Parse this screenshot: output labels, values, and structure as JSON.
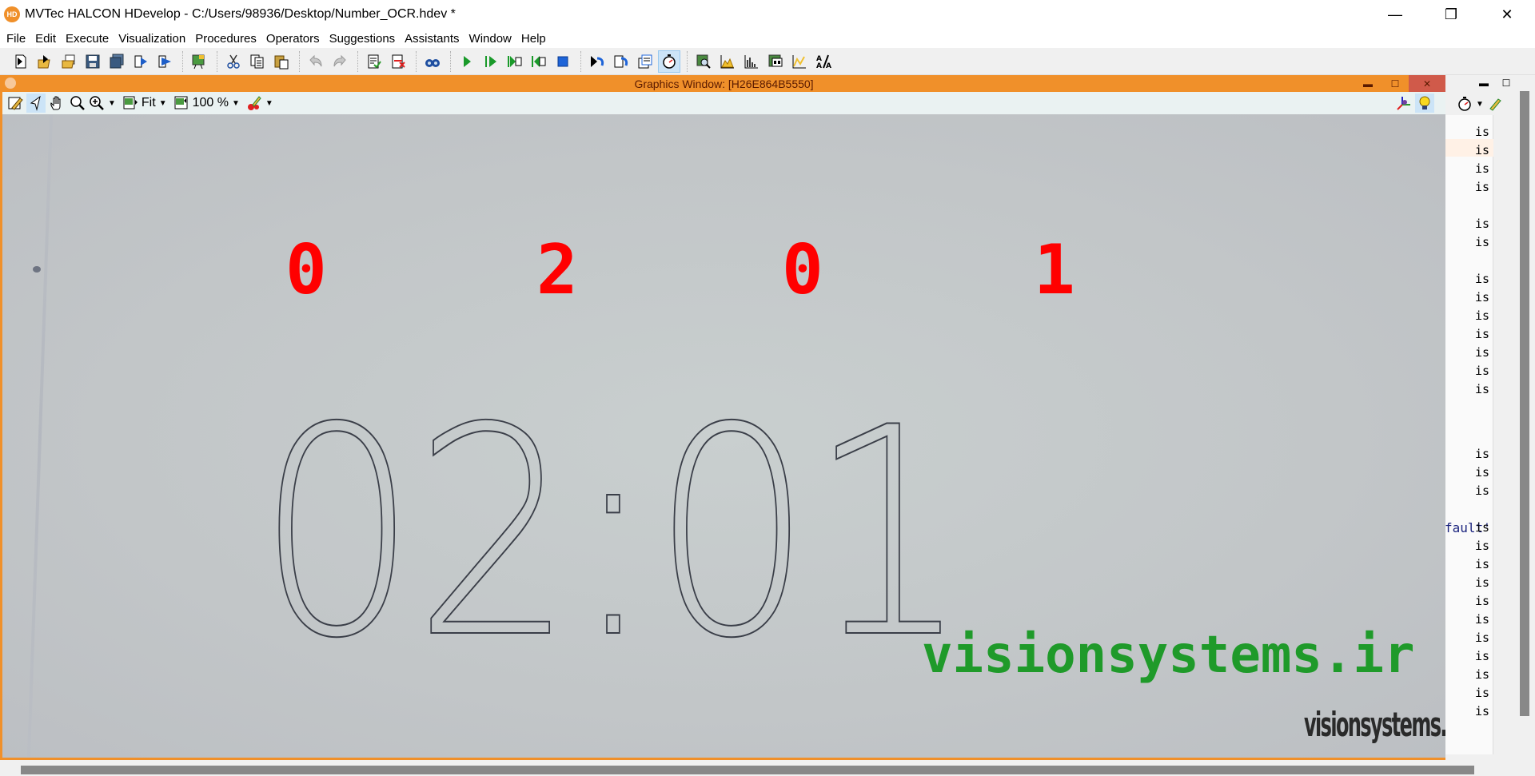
{
  "app": {
    "title": "MVTec HALCON HDevelop - C:/Users/98936/Desktop/Number_OCR.hdev *",
    "logo_text": "HD",
    "window_controls": {
      "minimize": "—",
      "restore": "❐",
      "close": "✕"
    }
  },
  "menu": {
    "items": [
      {
        "label": "File"
      },
      {
        "label": "Edit"
      },
      {
        "label": "Execute"
      },
      {
        "label": "Visualization"
      },
      {
        "label": "Procedures"
      },
      {
        "label": "Operators"
      },
      {
        "label": "Suggestions"
      },
      {
        "label": "Assistants"
      },
      {
        "label": "Window"
      },
      {
        "label": "Help"
      }
    ]
  },
  "toolbar": {
    "buttons": [
      {
        "icon": "new-program-icon"
      },
      {
        "icon": "open-program-icon"
      },
      {
        "icon": "open-example-icon"
      },
      {
        "icon": "save-icon"
      },
      {
        "icon": "save-all-icon"
      },
      {
        "icon": "export-icon"
      },
      {
        "icon": "export-library-icon"
      },
      {
        "icon": "image-acquisition-icon"
      },
      {
        "icon": "cut-icon"
      },
      {
        "icon": "copy-icon"
      },
      {
        "icon": "paste-icon"
      },
      {
        "icon": "undo-icon"
      },
      {
        "icon": "redo-icon"
      },
      {
        "icon": "activate-icon"
      },
      {
        "icon": "deactivate-icon"
      },
      {
        "icon": "find-icon"
      },
      {
        "icon": "run-icon"
      },
      {
        "icon": "step-over-icon"
      },
      {
        "icon": "step-forward-icon"
      },
      {
        "icon": "step-back-icon"
      },
      {
        "icon": "stop-icon"
      },
      {
        "icon": "reset-program-icon"
      },
      {
        "icon": "reset-procedure-icon"
      },
      {
        "icon": "clear-icon"
      },
      {
        "icon": "profiler-icon"
      },
      {
        "icon": "inspect-icon"
      },
      {
        "icon": "histogram-icon"
      },
      {
        "icon": "line-profile-icon"
      },
      {
        "icon": "region-features-icon"
      },
      {
        "icon": "feature-histogram-icon"
      },
      {
        "icon": "ocr-icon"
      }
    ]
  },
  "graphics_window": {
    "title": "Graphics Window: [H26E864B5550]",
    "controls": {
      "minimize": "▬",
      "maximize": "☐",
      "close": "✕"
    },
    "toolbar": {
      "fit_label": "Fit",
      "zoom_label": "100 %"
    },
    "ocr_results": [
      "0",
      "2",
      "0",
      "1"
    ],
    "image_text": "02:01",
    "watermark_main": "visionsystems.ir",
    "watermark_small": "visionsystems.ir",
    "colors": {
      "ocr_result": "#ff0000",
      "watermark": "#1f9a2a",
      "frame": "#f0902a"
    }
  },
  "side_panel": {
    "controls": {
      "minimize": "▬",
      "maximize": "☐"
    },
    "line_suffix": "is",
    "code_fragment": "fault'"
  }
}
